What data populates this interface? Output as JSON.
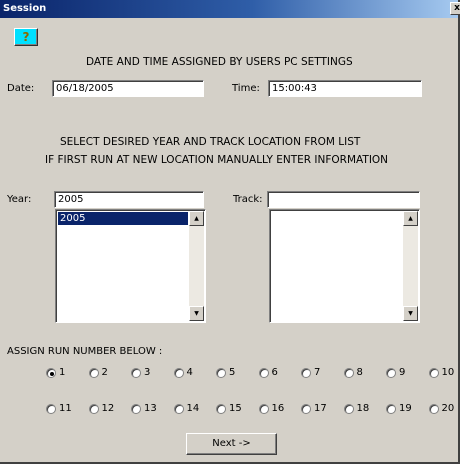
{
  "window": {
    "title": "Session",
    "close_label": "x"
  },
  "help": {
    "label": "?"
  },
  "datetime_heading": "DATE AND TIME  ASSIGNED BY USERS PC SETTINGS",
  "date": {
    "label": "Date:",
    "value": "06/18/2005"
  },
  "time": {
    "label": "Time:",
    "value": "15:00:43"
  },
  "select_heading_1": "SELECT DESIRED YEAR AND TRACK LOCATION FROM LIST",
  "select_heading_2": "IF FIRST RUN AT NEW LOCATION MANUALLY ENTER INFORMATION",
  "year": {
    "label": "Year:",
    "value": "2005",
    "list_items": [
      "2005"
    ]
  },
  "track": {
    "label": "Track:",
    "value": ""
  },
  "run": {
    "heading": "ASSIGN RUN NUMBER BELOW :",
    "options": [
      "1",
      "2",
      "3",
      "4",
      "5",
      "6",
      "7",
      "8",
      "9",
      "10",
      "11",
      "12",
      "13",
      "14",
      "15",
      "16",
      "17",
      "18",
      "19",
      "20"
    ],
    "selected": "1"
  },
  "next_label": "Next ->"
}
